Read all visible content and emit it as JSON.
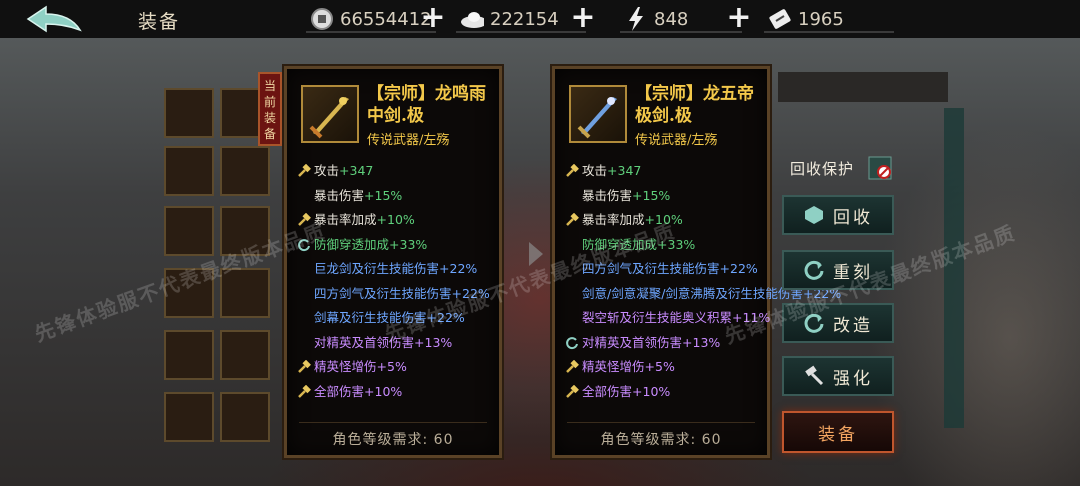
{
  "topbar": {
    "title": "装备",
    "resources": [
      {
        "icon": "coin-icon",
        "value": "66554412"
      },
      {
        "icon": "silver-ingot-icon",
        "value": "222154"
      },
      {
        "icon": "lightning-icon",
        "value": "848"
      },
      {
        "icon": "ticket-icon",
        "value": "1965"
      }
    ]
  },
  "current_tag": "当前装备",
  "left_item": {
    "name": "【宗师】龙鸣雨中剑.极",
    "subtitle": "传说武器/左殇",
    "attrs": [
      {
        "icon": "attack-icon",
        "label": "攻击",
        "value": "+347",
        "color": "white"
      },
      {
        "icon": "",
        "label": "暴击伤害",
        "value": "+15%",
        "color": "white"
      },
      {
        "icon": "attack-icon",
        "label": "暴击率加成",
        "value": "+10%",
        "color": "white"
      },
      {
        "icon": "refresh-icon",
        "label": "防御穿透加成",
        "value": "+33%",
        "color": "green"
      },
      {
        "icon": "",
        "label": "巨龙剑及衍生技能伤害",
        "value": "+22%",
        "color": "blue"
      },
      {
        "icon": "",
        "label": "四方剑气及衍生技能伤害",
        "value": "+22%",
        "color": "blue"
      },
      {
        "icon": "",
        "label": "剑幕及衍生技能伤害",
        "value": "+22%",
        "color": "blue"
      },
      {
        "icon": "",
        "label": "对精英及首领伤害",
        "value": "+13%",
        "color": "purple"
      },
      {
        "icon": "attack-icon",
        "label": "精英怪增伤",
        "value": "+5%",
        "color": "purple"
      },
      {
        "icon": "attack-icon",
        "label": "全部伤害",
        "value": "+10%",
        "color": "purple"
      }
    ],
    "requirement": "角色等级需求: 60"
  },
  "right_item": {
    "name": "【宗师】龙五帝极剑.极",
    "subtitle": "传说武器/左殇",
    "attrs": [
      {
        "icon": "attack-icon",
        "label": "攻击",
        "value": "+347",
        "color": "white"
      },
      {
        "icon": "",
        "label": "暴击伤害",
        "value": "+15%",
        "color": "white"
      },
      {
        "icon": "attack-icon",
        "label": "暴击率加成",
        "value": "+10%",
        "color": "white"
      },
      {
        "icon": "",
        "label": "防御穿透加成",
        "value": "+33%",
        "color": "green"
      },
      {
        "icon": "",
        "label": "四方剑气及衍生技能伤害",
        "value": "+22%",
        "color": "blue"
      },
      {
        "icon": "",
        "label": "剑意/剑意凝聚/剑意沸腾及衍生技能伤害",
        "value": "+22%",
        "color": "blue"
      },
      {
        "icon": "",
        "label": "裂空斩及衍生技能奥义积累",
        "value": "+11%",
        "color": "purple"
      },
      {
        "icon": "refresh-icon",
        "label": "对精英及首领伤害",
        "value": "+13%",
        "color": "purple"
      },
      {
        "icon": "attack-icon",
        "label": "精英怪增伤",
        "value": "+5%",
        "color": "purple"
      },
      {
        "icon": "attack-icon",
        "label": "全部伤害",
        "value": "+10%",
        "color": "purple"
      }
    ],
    "requirement": "角色等级需求: 60"
  },
  "actions": {
    "protect_label": "回收保护",
    "recycle": "回收",
    "reforge": "重刻",
    "modify": "改造",
    "enhance": "强化",
    "equip": "装备"
  },
  "watermark": "先锋体验服不代表最终版本品质",
  "colors": {
    "gold": "#f3c84a",
    "green": "#5fd07c",
    "blue": "#6ea6ff",
    "purple": "#c98cff"
  }
}
